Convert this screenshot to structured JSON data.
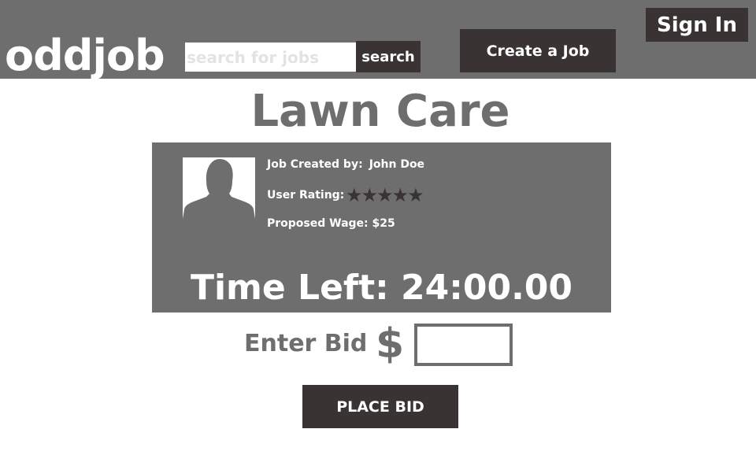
{
  "header": {
    "logo": "oddjob",
    "search_placeholder": "search for jobs",
    "search_value": "",
    "search_button": "search",
    "create_job_button": "Create a Job",
    "sign_in_button": "Sign In"
  },
  "job": {
    "title": "Lawn Care",
    "avatar_icon": "person-silhouette-icon",
    "created_by_label": "Job Created by:",
    "created_by_name": "John Doe",
    "rating_label": "User Rating:",
    "rating_stars": "★★★★★",
    "rating_value": 5,
    "rating_max": 5,
    "wage_label": "Proposed Wage:",
    "wage_value": "$25",
    "time_left_label": "Time Left:",
    "time_left_value": "24:00.00"
  },
  "bid": {
    "label": "Enter Bid",
    "currency": "$",
    "input_value": "",
    "place_bid_button": "PLACE BID"
  },
  "colors": {
    "header_bg": "#6e6e6e",
    "card_bg": "#6e6e6e",
    "button_bg": "#393333",
    "text_light": "#ffffff",
    "text_gray": "#6e6e6e"
  }
}
